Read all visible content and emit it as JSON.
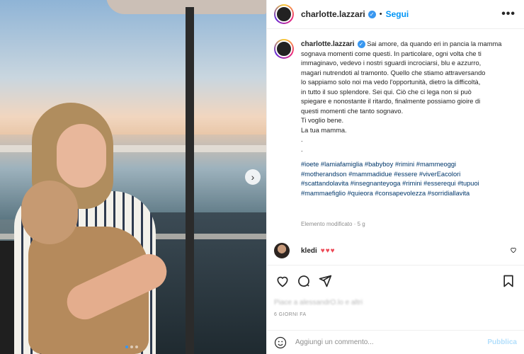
{
  "post": {
    "username": "charlotte.lazzari",
    "separator": "•",
    "follow_label": "Segui",
    "more_label": "•••",
    "caption_lines": [
      "Sai amore, da quando eri in pancia la mamma",
      "sognava momenti come questi. In particolare, ogni volta che ti",
      "immaginavo, vedevo i nostri sguardi incrociarsi, blu e azzurro,",
      "magari nutrendoti al tramonto. Quello che stiamo attraversando",
      "lo sappiamo solo noi ma vedo l'opportunità, dietro la difficoltà,",
      "in tutto il suo splendore. Sei qui. Ciò che ci lega non si può",
      "spiegare e nonostante il ritardo, finalmente possiamo gioire di",
      "questi momenti che tanto sognavo.",
      "Ti voglio bene.",
      "La tua mamma.",
      ".",
      "."
    ],
    "hashtag_lines": [
      "#ioete #lamiafamiglia #babyboy #rimini #mammeoggi",
      "#motherandson #mammadidue #essere #viverEacolori",
      "#scattandolavita #insegnanteyoga #rimini #esserequi #tupuoi",
      "#mammaefiglio #quieora #consapevolezza #sorridiallavita"
    ],
    "modified_label": "Elemento modificato · 5 g"
  },
  "comment": {
    "username": "kledi",
    "text": "♥♥♥"
  },
  "stats": {
    "likes_text": "Piace a alessandrO.lo e altri",
    "time_text": "6 GIORNI FA"
  },
  "composer": {
    "placeholder": "Aggiungi un commento...",
    "publish_label": "Pubblica"
  },
  "carousel": {
    "next_label": "›",
    "slides": 3,
    "active_index": 0
  },
  "colors": {
    "link_blue": "#0095f6",
    "hashtag": "#00376b",
    "heart_red": "#ed4956"
  }
}
